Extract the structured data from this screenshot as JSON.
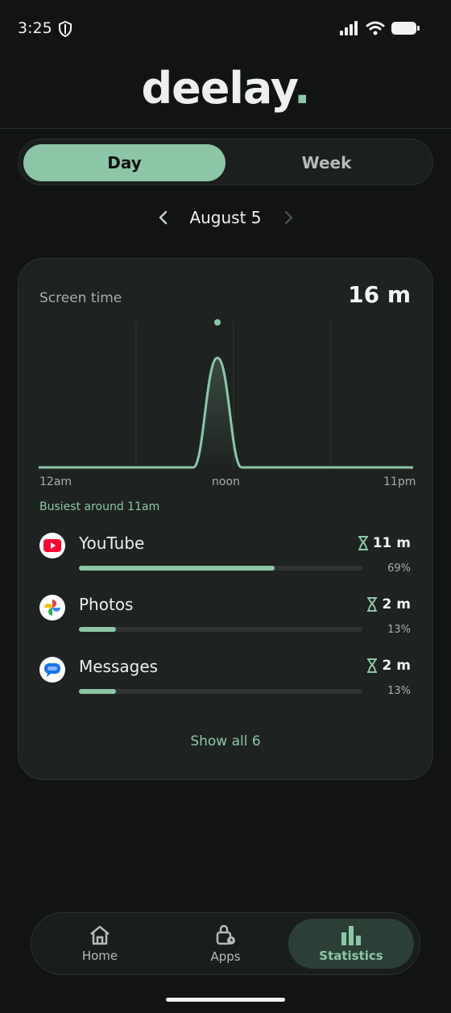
{
  "status_bar": {
    "time": "3:25"
  },
  "app": {
    "logo_text": "deelay",
    "logo_dot": "."
  },
  "segmented": {
    "day": "Day",
    "week": "Week",
    "selected": "Day"
  },
  "date_nav": {
    "label": "August 5"
  },
  "card": {
    "title": "Screen time",
    "total": "16 m",
    "axis": {
      "start": "12am",
      "mid": "noon",
      "end": "11pm"
    },
    "busiest": "Busiest around 11am",
    "apps": [
      {
        "name": "YouTube",
        "time": "11 m",
        "percent": "69%",
        "fraction": 0.69,
        "icon": "youtube-icon"
      },
      {
        "name": "Photos",
        "time": "2 m",
        "percent": "13%",
        "fraction": 0.13,
        "icon": "photos-icon"
      },
      {
        "name": "Messages",
        "time": "2 m",
        "percent": "13%",
        "fraction": 0.13,
        "icon": "messages-icon"
      }
    ],
    "show_all": "Show all 6"
  },
  "nav": {
    "home": "Home",
    "apps": "Apps",
    "statistics": "Statistics",
    "active": "Statistics"
  },
  "colors": {
    "accent": "#8dc6a7",
    "background": "#111413",
    "card": "#1e2220"
  }
}
